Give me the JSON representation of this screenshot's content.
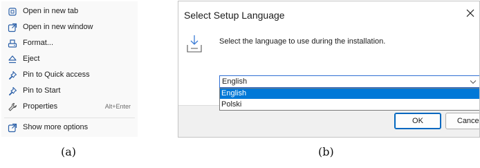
{
  "context_menu": {
    "items": [
      {
        "label": "Open in new tab",
        "icon": "open-new-tab-icon"
      },
      {
        "label": "Open in new window",
        "icon": "open-new-window-icon"
      },
      {
        "label": "Format...",
        "icon": "format-drive-icon"
      },
      {
        "label": "Eject",
        "icon": "eject-icon"
      },
      {
        "label": "Pin to Quick access",
        "icon": "pin-icon"
      },
      {
        "label": "Pin to Start",
        "icon": "pin-icon"
      },
      {
        "label": "Properties",
        "icon": "wrench-icon",
        "shortcut": "Alt+Enter"
      },
      {
        "label": "Show more options",
        "icon": "show-more-options-icon"
      }
    ]
  },
  "dialog": {
    "title": "Select Setup Language",
    "message": "Select the language to use during the installation.",
    "selected_language": "English",
    "options": [
      "English",
      "Polski"
    ],
    "ok_label": "OK",
    "cancel_label": "Cancel"
  },
  "captions": {
    "a": "(a)",
    "b": "(b)"
  },
  "colors": {
    "selection": "#0078d7",
    "focus_border": "#2f6ed2",
    "menu_background": "#f9f9f9"
  }
}
